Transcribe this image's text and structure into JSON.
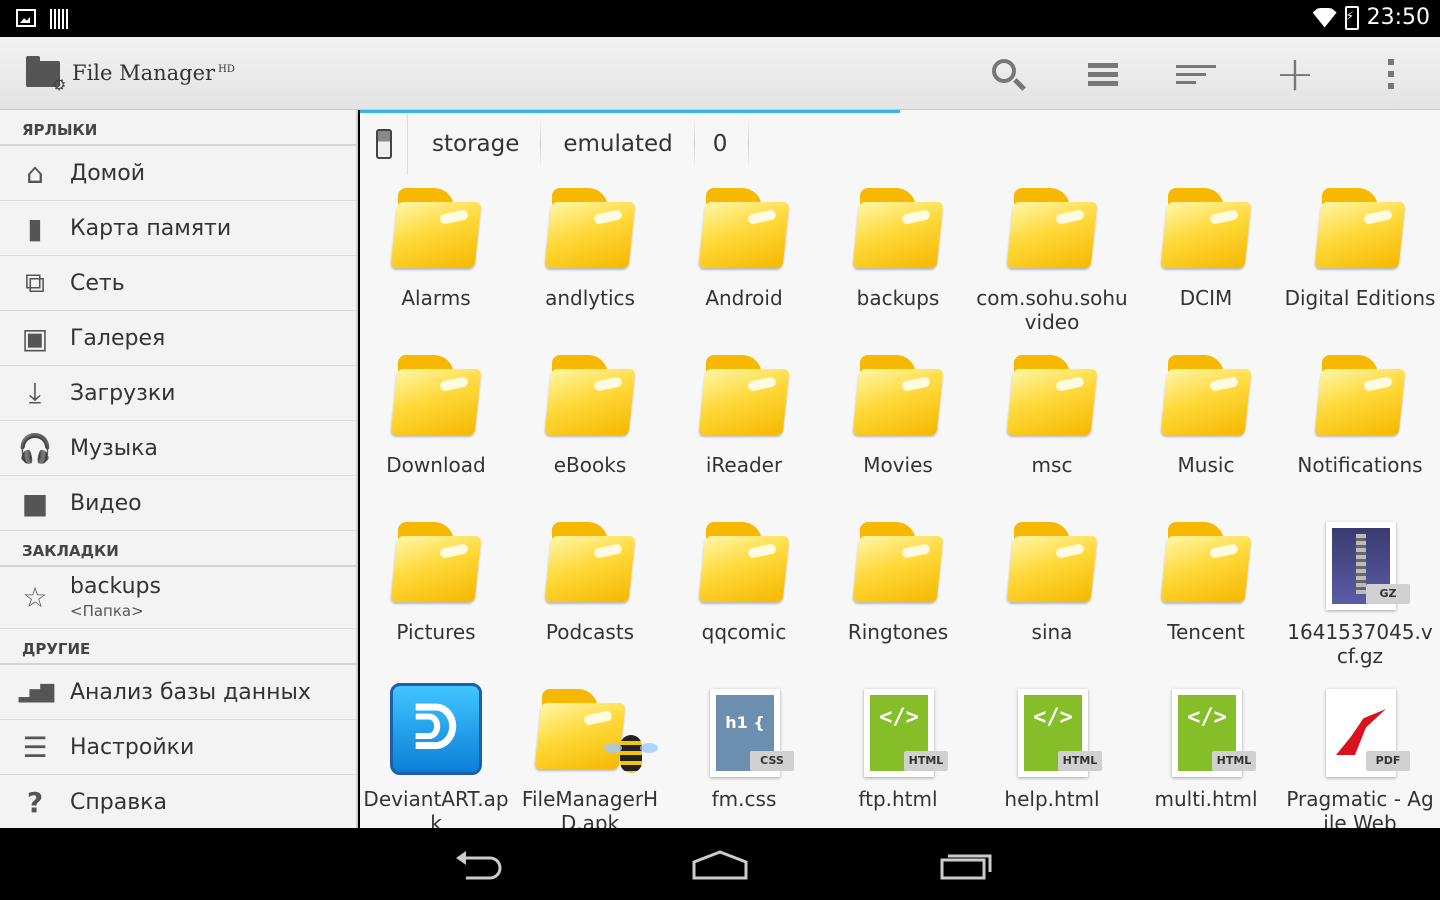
{
  "status": {
    "time": "23:50"
  },
  "app": {
    "title": "File Manager",
    "title_sup": "HD"
  },
  "sidebar": {
    "sections": {
      "shortcuts": "ЯРЛЫКИ",
      "bookmarks": "ЗАКЛАДКИ",
      "other": "ДРУГИЕ"
    },
    "shortcuts": [
      {
        "label": "Домой",
        "icon": "home-icon"
      },
      {
        "label": "Карта памяти",
        "icon": "sd-card-icon"
      },
      {
        "label": "Сеть",
        "icon": "network-icon"
      },
      {
        "label": "Галерея",
        "icon": "gallery-icon"
      },
      {
        "label": "Загрузки",
        "icon": "download-icon"
      },
      {
        "label": "Музыка",
        "icon": "headphones-icon"
      },
      {
        "label": "Видео",
        "icon": "video-icon"
      }
    ],
    "bookmark": {
      "label": "backups",
      "sub": "<Папка>",
      "icon": "bookmark-icon"
    },
    "other": [
      {
        "label": "Анализ базы данных",
        "icon": "bar-chart-icon"
      },
      {
        "label": "Настройки",
        "icon": "sliders-icon"
      },
      {
        "label": "Справка",
        "icon": "help-icon"
      }
    ]
  },
  "breadcrumb": [
    "storage",
    "emulated",
    "0"
  ],
  "files": [
    {
      "name": "Alarms",
      "type": "folder"
    },
    {
      "name": "andlytics",
      "type": "folder"
    },
    {
      "name": "Android",
      "type": "folder"
    },
    {
      "name": "backups",
      "type": "folder"
    },
    {
      "name": "com.sohu.sohuvideo",
      "type": "folder"
    },
    {
      "name": "DCIM",
      "type": "folder"
    },
    {
      "name": "Digital Editions",
      "type": "folder"
    },
    {
      "name": "Download",
      "type": "folder"
    },
    {
      "name": "eBooks",
      "type": "folder"
    },
    {
      "name": "iReader",
      "type": "folder"
    },
    {
      "name": "Movies",
      "type": "folder"
    },
    {
      "name": "msc",
      "type": "folder"
    },
    {
      "name": "Music",
      "type": "folder"
    },
    {
      "name": "Notifications",
      "type": "folder"
    },
    {
      "name": "Pictures",
      "type": "folder"
    },
    {
      "name": "Podcasts",
      "type": "folder"
    },
    {
      "name": "qqcomic",
      "type": "folder"
    },
    {
      "name": "Ringtones",
      "type": "folder"
    },
    {
      "name": "sina",
      "type": "folder"
    },
    {
      "name": "Tencent",
      "type": "folder"
    },
    {
      "name": "1641537045.vcf.gz",
      "type": "gz",
      "tag": "GZ"
    },
    {
      "name": "DeviantART.apk",
      "type": "apk-deviantart"
    },
    {
      "name": "FileManagerHD.apk",
      "type": "apk-filemanager"
    },
    {
      "name": "fm.css",
      "type": "css",
      "tag": "CSS",
      "preview": "h1 {"
    },
    {
      "name": "ftp.html",
      "type": "html",
      "tag": "HTML",
      "preview": "</>"
    },
    {
      "name": "help.html",
      "type": "html",
      "tag": "HTML",
      "preview": "</>"
    },
    {
      "name": "multi.html",
      "type": "html",
      "tag": "HTML",
      "preview": "</>"
    },
    {
      "name": "Pragmatic - Agile Web",
      "type": "pdf",
      "tag": "PDF"
    }
  ]
}
